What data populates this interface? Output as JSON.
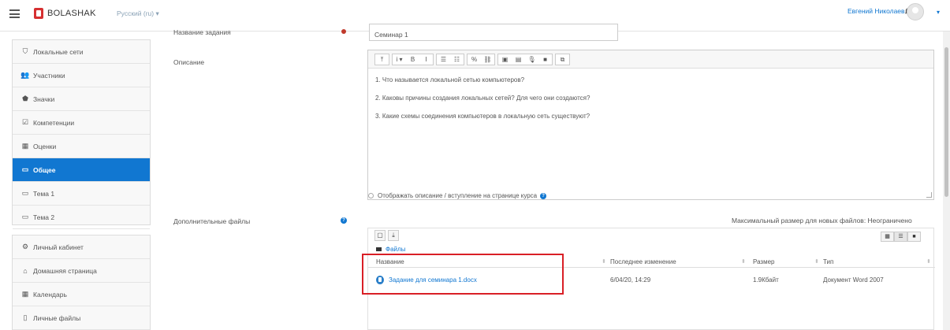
{
  "header": {
    "brand": "BOLASHAK",
    "language": "Русский (ru) ▾",
    "user_name": "Евгений Николаев",
    "caret": "▾"
  },
  "sidebar": {
    "items": [
      {
        "label": "Локальные сети",
        "icon": "graduation-cap-icon",
        "glyph": "⛉"
      },
      {
        "label": "Участники",
        "icon": "users-icon",
        "glyph": "👥"
      },
      {
        "label": "Значки",
        "icon": "shield-icon",
        "glyph": "⬟"
      },
      {
        "label": "Компетенции",
        "icon": "check-square-icon",
        "glyph": "☑"
      },
      {
        "label": "Оценки",
        "icon": "table-icon",
        "glyph": "▦"
      },
      {
        "label": "Общее",
        "icon": "folder-icon",
        "glyph": "▭",
        "active": true
      },
      {
        "label": "Тема 1",
        "icon": "folder-icon",
        "glyph": "▭"
      },
      {
        "label": "Тема 2",
        "icon": "folder-icon",
        "glyph": "▭"
      }
    ],
    "items2": [
      {
        "label": "Личный кабинет",
        "icon": "dashboard-icon",
        "glyph": "⚙"
      },
      {
        "label": "Домашняя страница",
        "icon": "home-icon",
        "glyph": "⌂"
      },
      {
        "label": "Календарь",
        "icon": "calendar-icon",
        "glyph": "▦"
      },
      {
        "label": "Личные файлы",
        "icon": "file-icon",
        "glyph": "▯"
      }
    ]
  },
  "form": {
    "name_label": "Название задания",
    "name_value": "Семинар 1",
    "description_label": "Описание",
    "description_lines": [
      "1. Что называется локальной сетью компьютеров?",
      "2. Каковы причины создания локальных сетей? Для чего они создаются?",
      "3. Какие схемы соединения компьютеров в локальную сеть существуют?"
    ],
    "show_description_label": "Отображать описание / вступление на странице курса",
    "files_label": "Дополнительные файлы",
    "max_size": "Максимальный размер для новых файлов: Неограничено"
  },
  "toolbar": {
    "buttons": [
      "⤒",
      "i ▾",
      "B",
      "I",
      "☰",
      "☷",
      "%",
      "⛓",
      "▣",
      "▤",
      "🎙",
      "■",
      "⧉"
    ]
  },
  "file_manager": {
    "breadcrumb": "Файлы",
    "columns": [
      "Название",
      "Последнее изменение",
      "Размер",
      "Тип"
    ],
    "rows": [
      {
        "name": "Задание для семинара 1.docx",
        "modified": "6/04/20, 14:29",
        "size": "1.9Кбайт",
        "type": "Документ Word 2007"
      }
    ]
  },
  "colors": {
    "accent": "#1177d1",
    "highlight_box": "#d91f26"
  }
}
